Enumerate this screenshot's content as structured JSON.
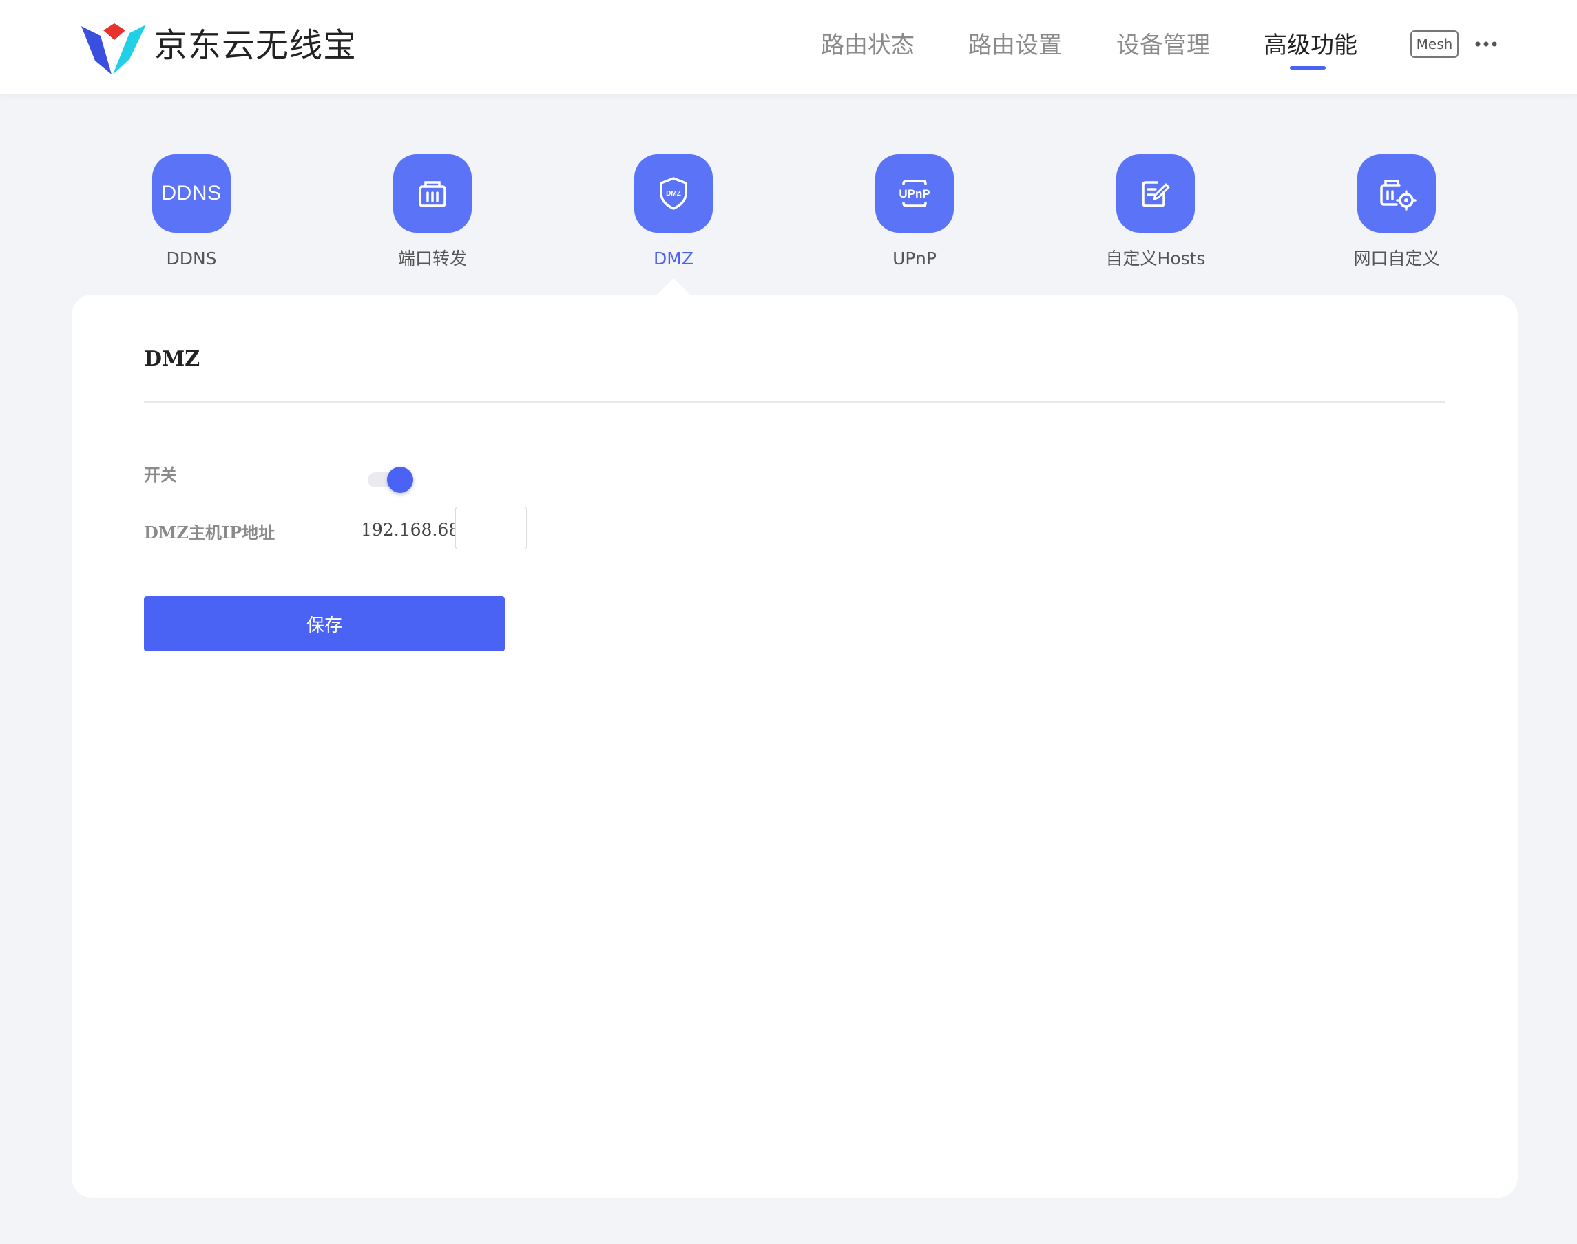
{
  "header": {
    "brand": "京东云无线宝",
    "nav": [
      {
        "label": "路由状态"
      },
      {
        "label": "路由设置"
      },
      {
        "label": "设备管理"
      },
      {
        "label": "高级功能",
        "active": true
      }
    ],
    "mesh_label": "Mesh",
    "more_icon": "more-horizontal-icon"
  },
  "features": [
    {
      "label": "DDNS",
      "icon": "ddns-icon",
      "icon_text": "DDNS"
    },
    {
      "label": "端口转发",
      "icon": "port-forward-icon"
    },
    {
      "label": "DMZ",
      "icon": "dmz-shield-icon",
      "icon_text": "DMZ",
      "active": true
    },
    {
      "label": "UPnP",
      "icon": "upnp-icon",
      "icon_text": "UPnP"
    },
    {
      "label": "自定义Hosts",
      "icon": "edit-document-icon"
    },
    {
      "label": "网口自定义",
      "icon": "port-settings-icon"
    }
  ],
  "panel": {
    "title": "DMZ",
    "switch_label": "开关",
    "switch_on": true,
    "host_ip_label": "DMZ主机IP地址",
    "ip_prefix": "192.168.68.",
    "ip_last_octet": "",
    "save_label": "保存"
  },
  "colors": {
    "accent": "#4b63f4",
    "icon_bg": "#5b73f7",
    "page_bg": "#f3f4f8",
    "logo_blue": "#3a4fe0",
    "logo_cyan": "#20d0e6",
    "logo_red": "#e8322e"
  }
}
